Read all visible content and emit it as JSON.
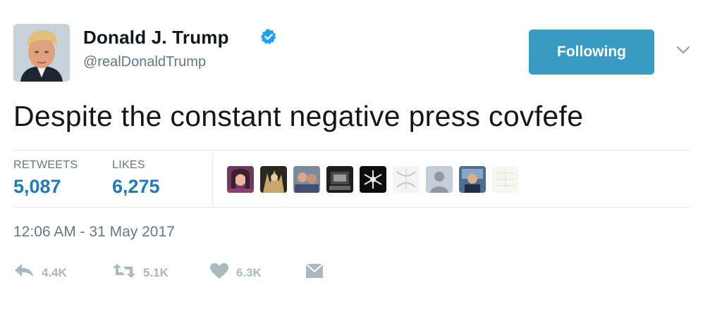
{
  "user": {
    "display_name": "Donald J. Trump",
    "handle": "@realDonaldTrump",
    "verified": true
  },
  "follow_button": {
    "label": "Following",
    "color": "#3a9bc2"
  },
  "tweet": {
    "text": "Despite the constant negative press covfefe"
  },
  "stats": {
    "retweets": {
      "label": "RETWEETS",
      "value": "5,087"
    },
    "likes": {
      "label": "LIKES",
      "value": "6,275"
    }
  },
  "timestamp": "12:06 AM - 31 May 2017",
  "actions": {
    "reply": {
      "icon": "reply-icon",
      "count": "4.4K"
    },
    "retweet": {
      "icon": "retweet-icon",
      "count": "5.1K"
    },
    "like": {
      "icon": "heart-icon",
      "count": "6.3K"
    },
    "dm": {
      "icon": "envelope-icon"
    }
  },
  "colors": {
    "accent": "#1f7bb5",
    "muted": "#657786",
    "action_gray": "#aab8c2",
    "verified_blue": "#1da1f2"
  }
}
